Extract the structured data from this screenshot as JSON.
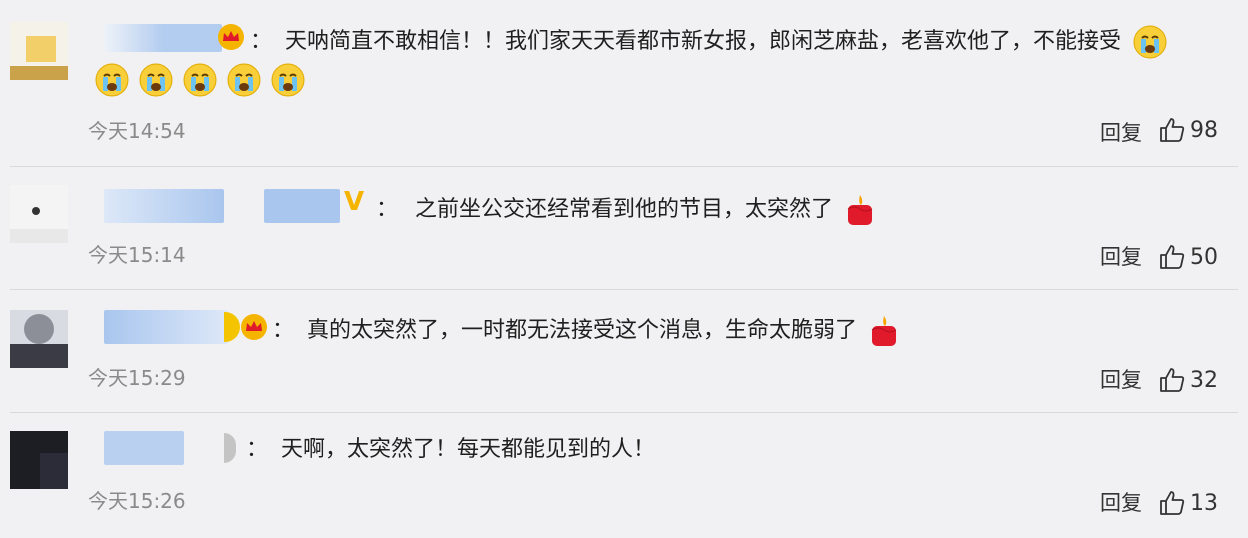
{
  "comments": [
    {
      "separator": "：",
      "text": "天呐简直不敢相信！！我们家天天看都市新女报，郎闲芝麻盐，老喜欢他了，不能接受",
      "time": "今天14:54",
      "reply_label": "回复",
      "likes": "98",
      "trailing_emoji": "crying-face",
      "second_line_emojis": [
        "crying-face",
        "crying-face",
        "crying-face",
        "crying-face",
        "crying-face"
      ]
    },
    {
      "separator": "：",
      "text": "之前坐公交还经常看到他的节目，太突然了",
      "time": "今天15:14",
      "reply_label": "回复",
      "likes": "50",
      "trailing_emoji": "candle"
    },
    {
      "separator": "：",
      "text": "真的太突然了，一时都无法接受这个消息，生命太脆弱了",
      "time": "今天15:29",
      "reply_label": "回复",
      "likes": "32",
      "trailing_emoji": "candle"
    },
    {
      "separator": "：",
      "text": "天啊，太突然了！每天都能见到的人！",
      "time": "今天15:26",
      "reply_label": "回复",
      "likes": "13"
    }
  ],
  "colors": {
    "background": "#f1f1f3",
    "divider": "#d9d9dc",
    "time": "#8a8a8a",
    "blurred_name": "#a9c6ee",
    "crown": "#f5b400",
    "candle": "#e0192b"
  }
}
